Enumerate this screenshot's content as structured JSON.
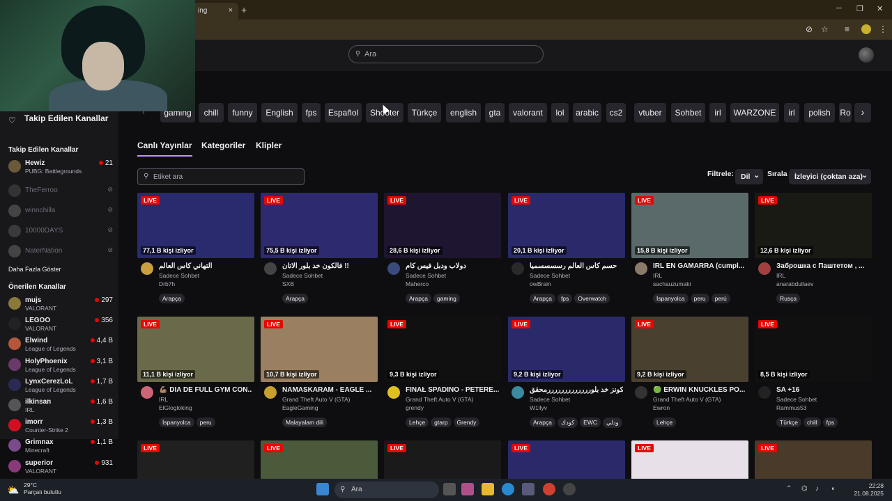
{
  "browser": {
    "tab_title": "ing",
    "tab_close": "×",
    "new_tab": "+",
    "min": "─",
    "max": "❐",
    "close": "✕"
  },
  "nav": {
    "search_placeholder": "Ara"
  },
  "sidebar": {
    "header": "Takip Edilen Kanallar",
    "followed_title": "Takip Edilen Kanallar",
    "followed": [
      {
        "name": "Hewiz",
        "category": "PUBG: Battlegrounds",
        "viewers": "21",
        "live": true,
        "color": "#6b5a3a"
      },
      {
        "name": "TheFerroo",
        "live": false,
        "color": "#333"
      },
      {
        "name": "winnchilla",
        "live": false,
        "color": "#444"
      },
      {
        "name": "10000DAYS",
        "live": false,
        "color": "#3a3a3a"
      },
      {
        "name": "NaterNation",
        "live": false,
        "color": "#444"
      }
    ],
    "show_more": "Daha Fazla Göster",
    "recommended_title": "Önerilen Kanallar",
    "recommended": [
      {
        "name": "mujs",
        "category": "VALORANT",
        "viewers": "297",
        "color": "#8a7a3a"
      },
      {
        "name": "LEGOO",
        "category": "VALORANT",
        "viewers": "356",
        "color": "#222"
      },
      {
        "name": "Elwind",
        "category": "League of Legends",
        "viewers": "4,4 B",
        "color": "#b5553a"
      },
      {
        "name": "HolyPhoenix",
        "category": "League of Legends",
        "viewers": "3,1 B",
        "color": "#6a3a6a"
      },
      {
        "name": "LynxCerezLoL",
        "category": "League of Legends",
        "viewers": "1,7 B",
        "color": "#2a2a55"
      },
      {
        "name": "ilkinsan",
        "category": "IRL",
        "viewers": "1,6 B",
        "color": "#555"
      },
      {
        "name": "imorr",
        "category": "Counter-Strike 2",
        "viewers": "1,3 B",
        "color": "#d01020"
      },
      {
        "name": "Grimnax",
        "category": "Minecraft",
        "viewers": "1,1 B",
        "color": "#7a4a8a"
      },
      {
        "name": "superior",
        "category": "VALORANT",
        "viewers": "931",
        "color": "#8a3a7a"
      }
    ]
  },
  "tags": [
    "gaming",
    "chill",
    "funny",
    "English",
    "fps",
    "Español",
    "Shooter",
    "Türkçe",
    "english",
    "gta",
    "valorant",
    "lol",
    "arabic",
    "cs2",
    "vtuber",
    "Sohbet",
    "irl",
    "WARZONE",
    "irl",
    "polish",
    "Ro"
  ],
  "subtabs": [
    "Canlı Yayınlar",
    "Kategoriler",
    "Klipler"
  ],
  "tag_search_placeholder": "Etiket ara",
  "filters": {
    "filter_label": "Filtrele:",
    "lang_label": "Dil",
    "sort_label": "Sırala",
    "sort_value": "İzleyici (çoktan aza)"
  },
  "live_badge": "LIVE",
  "streams": [
    {
      "title": "التهاني كاس العالم",
      "category": "Sadece Sohbet",
      "channel": "Drb7h",
      "viewers": "77,1 B kişi izliyor",
      "tags": [
        "Arapça"
      ],
      "bg": "#2a2a6e",
      "av": "#c8a040"
    },
    {
      "title": "فالكون خد بلور الاتان !!",
      "category": "Sadece Sohbet",
      "channel": "SXB",
      "viewers": "75,5 B kişi izliyor",
      "tags": [
        "Arapça"
      ],
      "bg": "#2e2a70",
      "av": "#444"
    },
    {
      "title": "دولاب ودبل فيس كام",
      "category": "Sadece Sohbet",
      "channel": "Maherco",
      "viewers": "28,6 B kişi izliyor",
      "tags": [
        "Arapça",
        "gaming"
      ],
      "bg": "#1e1630",
      "av": "#3a4a7a"
    },
    {
      "title": "حسم كأس العالم رسسسسميا",
      "category": "Sadece Sohbet",
      "channel": "owBrain",
      "viewers": "20,1 B kişi izliyor",
      "tags": [
        "Arapça",
        "fps",
        "Overwatch"
      ],
      "bg": "#2a2a6a",
      "av": "#2a2a2a"
    },
    {
      "title": "IRL EN GAMARRA (cumpl...",
      "category": "IRL",
      "channel": "sachauzumaki",
      "viewers": "15,8 B kişi izliyor",
      "tags": [
        "İspanyolca",
        "peru",
        "perú"
      ],
      "bg": "#5a6a6a",
      "av": "#8a7a6a"
    },
    {
      "title": "Заброшка с Паштетом , ...",
      "category": "IRL",
      "channel": "anarabdullaev",
      "viewers": "12,6 B kişi izliyor",
      "tags": [
        "Rusça"
      ],
      "bg": "#1a1a14",
      "av": "#a04040"
    },
    {
      "title": "💪🏽 DIA DE FULL GYM CON...",
      "category": "IRL",
      "channel": "ElGlogloking",
      "viewers": "11,1 B kişi izliyor",
      "tags": [
        "İspanyolca",
        "peru"
      ],
      "bg": "#6a6a4a",
      "av": "#cc6677"
    },
    {
      "title": "NAMASKARAM - EAGLE ...",
      "category": "Grand Theft Auto V (GTA)",
      "channel": "EagleGaming",
      "viewers": "10,7 B kişi izliyor",
      "tags": [
        "Malayalam dili"
      ],
      "bg": "#9a8060",
      "av": "#c8a030"
    },
    {
      "title": "FINAŁ SPADINO - PETERE...",
      "category": "Grand Theft Auto V (GTA)",
      "channel": "grendy",
      "viewers": "9,3 B kişi izliyor",
      "tags": [
        "Lehçe",
        "gtarp",
        "Grendy"
      ],
      "bg": "#101010",
      "av": "#e0c020"
    },
    {
      "title": "فالكونز خد بلورررررررررررررمحقق...",
      "category": "Sadece Sohbet",
      "channel": "W1llyv",
      "viewers": "9,2 B kişi izliyor",
      "tags": [
        "Arapça",
        "كودك",
        "EWC",
        "ودلي"
      ],
      "bg": "#2a2a6a",
      "av": "#3a8aa0"
    },
    {
      "title": "🟢 ERWIN KNUCKLES PO...",
      "category": "Grand Theft Auto V (GTA)",
      "channel": "Ewron",
      "viewers": "9,2 B kişi izliyor",
      "tags": [
        "Lehçe"
      ],
      "bg": "#4a4030",
      "av": "#333"
    },
    {
      "title": "SA +16",
      "category": "Sadece Sohbet",
      "channel": "Rammus53",
      "viewers": "8,5 B kişi izliyor",
      "tags": [
        "Türkçe",
        "chill",
        "fps"
      ],
      "bg": "#101010",
      "av": "#222"
    },
    {
      "title": "",
      "category": "",
      "channel": "",
      "viewers": "",
      "tags": [],
      "bg": "#202020",
      "av": "#000"
    },
    {
      "title": "",
      "category": "",
      "channel": "",
      "viewers": "",
      "tags": [],
      "bg": "#4a5a3a",
      "av": "#000"
    },
    {
      "title": "",
      "category": "",
      "channel": "",
      "viewers": "",
      "tags": [],
      "bg": "#1a1a1a",
      "av": "#000"
    },
    {
      "title": "",
      "category": "",
      "channel": "",
      "viewers": "",
      "tags": [],
      "bg": "#2a2a6a",
      "av": "#000"
    },
    {
      "title": "",
      "category": "",
      "channel": "",
      "viewers": "",
      "tags": [],
      "bg": "#e8e0e8",
      "av": "#000"
    },
    {
      "title": "",
      "category": "",
      "channel": "",
      "viewers": "",
      "tags": [],
      "bg": "#4a3a2a",
      "av": "#000"
    }
  ],
  "taskbar": {
    "temp": "29°C",
    "weather": "Parçalı bulutlu",
    "search": "Ara",
    "time": "22:28",
    "date": "21.08.2025"
  }
}
